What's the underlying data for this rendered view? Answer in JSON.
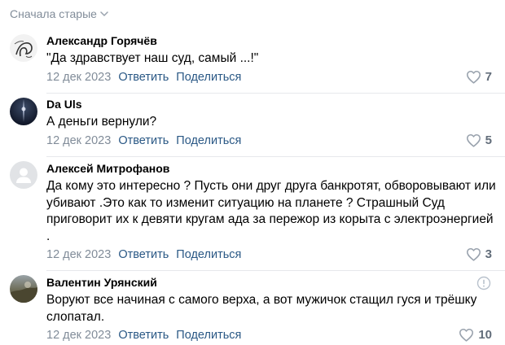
{
  "sort": {
    "label": "Сначала старые"
  },
  "comments": [
    {
      "author": "Александр Горячёв",
      "text": "\"Да здравствует наш суд, самый ...!\"",
      "date": "12 дек 2023",
      "reply": "Ответить",
      "share": "Поделиться",
      "likes": "7"
    },
    {
      "author": "Da Uls",
      "text": "А деньги вернули?",
      "date": "12 дек 2023",
      "reply": "Ответить",
      "share": "Поделиться",
      "likes": "5"
    },
    {
      "author": "Алексей Митрофанов",
      "text": "Да кому это интересно ? Пусть они друг друга банкротят, обворовывают или убивают .Это как то изменит ситуацию на планете ? Страшный Суд приговорит их к девяти кругам ада за пережор из корыта с электроэнергией .",
      "date": "12 дек 2023",
      "reply": "Ответить",
      "share": "Поделиться",
      "likes": "3"
    },
    {
      "author": "Валентин Урянский",
      "text": "Воруют все начиная с самого верха, а вот мужичок стащил гуся и трёшку слопатал.",
      "date": "12 дек 2023",
      "reply": "Ответить",
      "share": "Поделиться",
      "likes": "10"
    }
  ],
  "colors": {
    "link": "#2a5885",
    "muted": "#818c99",
    "like_icon": "#99a2ad",
    "divider": "#e7e8ec"
  },
  "icons": [
    "chevron-down-icon",
    "heart-icon",
    "report-icon",
    "default-avatar-icon"
  ]
}
